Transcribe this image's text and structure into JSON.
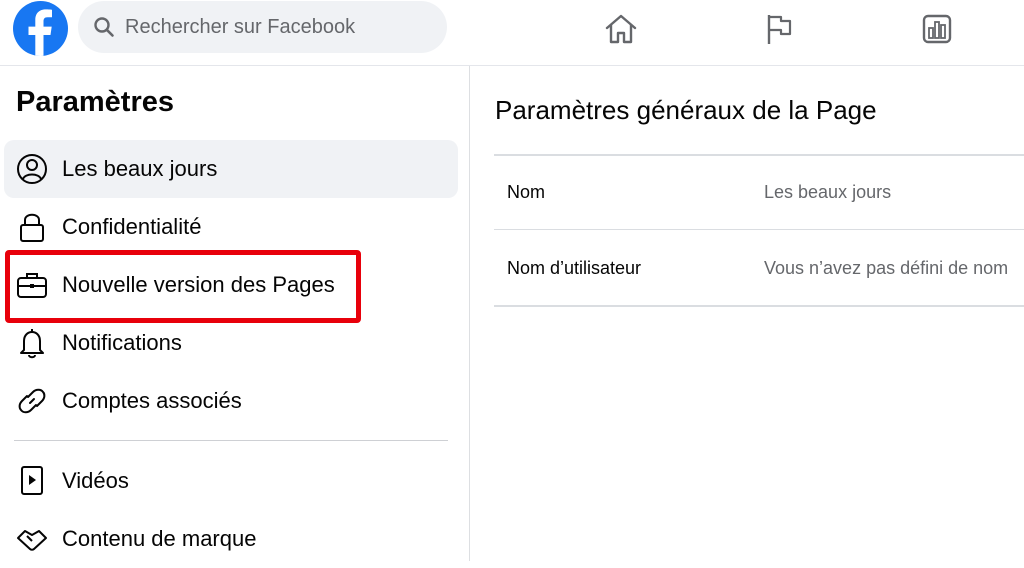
{
  "topbar": {
    "search_placeholder": "Rechercher sur Facebook",
    "nav_icons": [
      "home-icon",
      "flag-icon",
      "insights-icon"
    ]
  },
  "sidebar": {
    "title": "Paramètres",
    "items": [
      {
        "label": "Les beaux jours",
        "icon": "user-circle-icon",
        "active": true
      },
      {
        "label": "Confidentialité",
        "icon": "lock-icon"
      },
      {
        "label": "Nouvelle version des Pages",
        "icon": "briefcase-icon",
        "highlighted": true
      },
      {
        "label": "Notifications",
        "icon": "bell-icon"
      },
      {
        "label": "Comptes associés",
        "icon": "link-icon"
      },
      {
        "label": "Vidéos",
        "icon": "video-icon"
      },
      {
        "label": "Contenu de marque",
        "icon": "handshake-icon"
      }
    ]
  },
  "main": {
    "title": "Paramètres généraux de la Page",
    "rows": [
      {
        "label": "Nom",
        "value": "Les beaux jours"
      },
      {
        "label": "Nom d’utilisateur",
        "value": "Vous n’avez pas défini de nom"
      }
    ]
  },
  "colors": {
    "brand": "#1877f2",
    "highlight": "#e8000b",
    "active_bg": "#f0f2f5"
  }
}
